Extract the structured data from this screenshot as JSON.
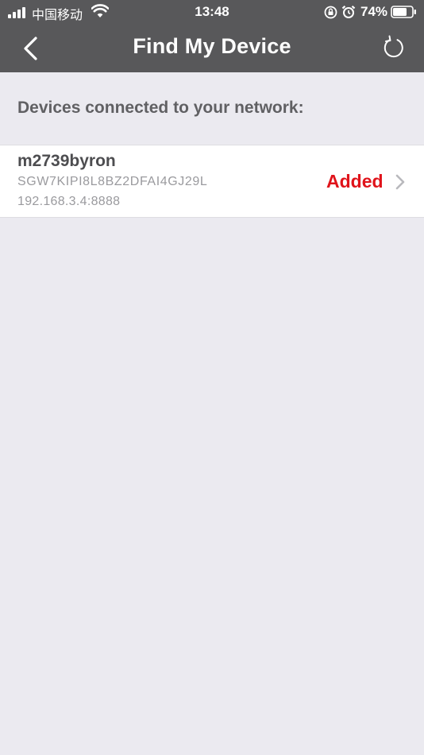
{
  "status_bar": {
    "carrier": "中国移动",
    "time": "13:48",
    "battery": "74%"
  },
  "nav": {
    "title": "Find My Device",
    "back_icon": "chevron-left-icon",
    "refresh_icon": "refresh-icon"
  },
  "section": {
    "header": "Devices connected to your network:"
  },
  "devices": [
    {
      "name": "m2739byron",
      "serial": "SGW7KIPI8L8BZ2DFAI4GJ29L",
      "address": "192.168.3.4:8888",
      "status": "Added"
    }
  ],
  "colors": {
    "nav_background": "#58585a",
    "page_background": "#ebeaf0",
    "status_added": "#e0141b"
  }
}
